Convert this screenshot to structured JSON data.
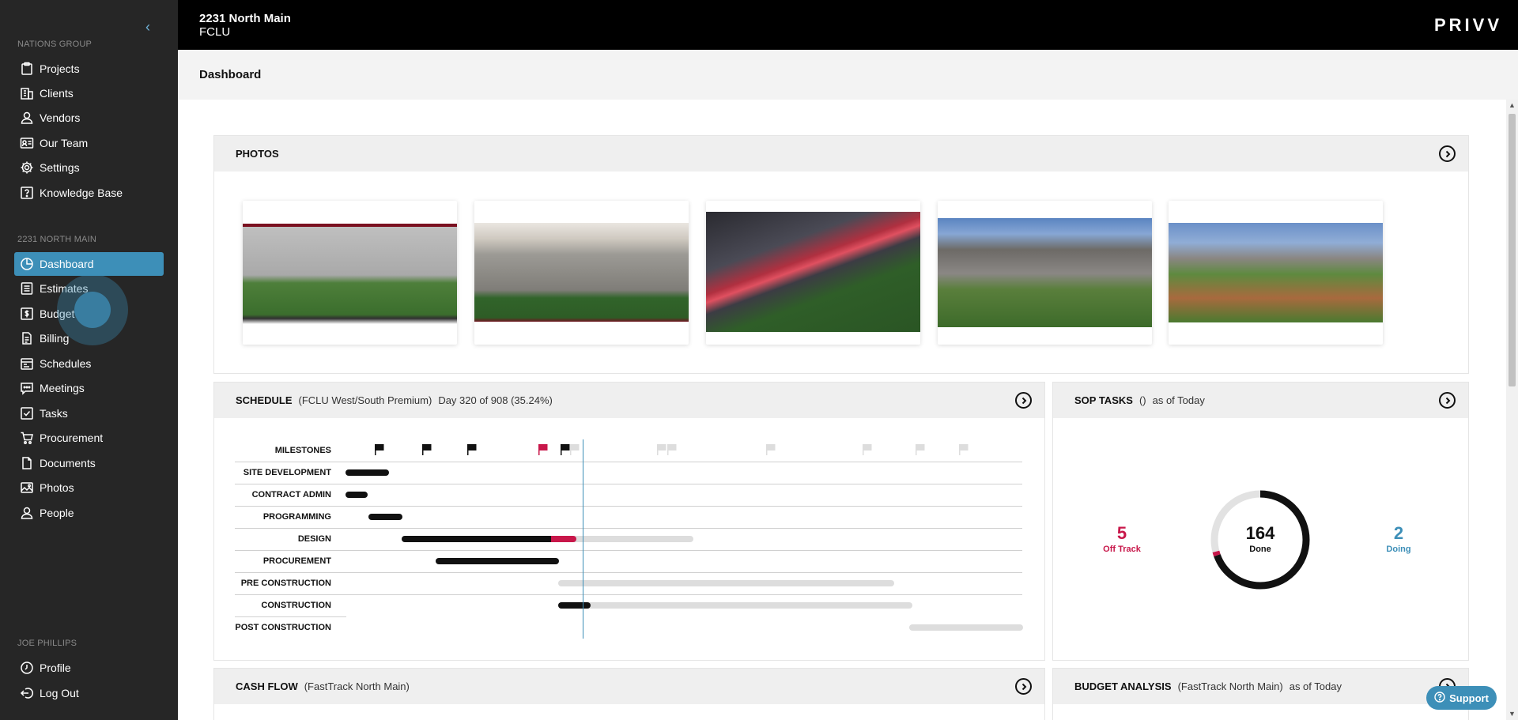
{
  "sidebar": {
    "group1_label": "NATIONS GROUP",
    "group1": [
      {
        "label": "Projects",
        "icon": "clipboard-icon"
      },
      {
        "label": "Clients",
        "icon": "building-icon"
      },
      {
        "label": "Vendors",
        "icon": "person-icon"
      },
      {
        "label": "Our Team",
        "icon": "id-card-icon"
      },
      {
        "label": "Settings",
        "icon": "gear-icon"
      },
      {
        "label": "Knowledge Base",
        "icon": "question-box-icon"
      }
    ],
    "group2_label": "2231 NORTH MAIN",
    "group2": [
      {
        "label": "Dashboard",
        "icon": "pie-icon",
        "active": true
      },
      {
        "label": "Estimates",
        "icon": "list-icon"
      },
      {
        "label": "Budget",
        "icon": "dollar-icon"
      },
      {
        "label": "Billing",
        "icon": "document-icon"
      },
      {
        "label": "Schedules",
        "icon": "calendar-icon"
      },
      {
        "label": "Meetings",
        "icon": "chat-icon"
      },
      {
        "label": "Tasks",
        "icon": "checkbox-icon"
      },
      {
        "label": "Procurement",
        "icon": "cart-icon"
      },
      {
        "label": "Documents",
        "icon": "file-icon"
      },
      {
        "label": "Photos",
        "icon": "image-icon"
      },
      {
        "label": "People",
        "icon": "person-icon"
      }
    ],
    "group3_label": "JOE PHILLIPS",
    "group3": [
      {
        "label": "Profile",
        "icon": "clock-icon"
      },
      {
        "label": "Log Out",
        "icon": "logout-icon"
      }
    ]
  },
  "topbar": {
    "project": "2231 North Main",
    "subproject": "FCLU",
    "brand": "PRIVV"
  },
  "page": {
    "title": "Dashboard"
  },
  "photos": {
    "title": "PHOTOS",
    "count": 5
  },
  "schedule": {
    "title": "SCHEDULE",
    "subtitle": "(FCLU West/South Premium)",
    "progress": "Day 320 of 908 (35.24%)",
    "rows": [
      "MILESTONES",
      "SITE DEVELOPMENT",
      "CONTRACT ADMIN",
      "PROGRAMMING",
      "DESIGN",
      "PROCUREMENT",
      "PRE CONSTRUCTION",
      "CONSTRUCTION",
      "POST CONSTRUCTION"
    ]
  },
  "sop": {
    "title": "SOP TASKS",
    "subtitle": "()",
    "asof": "as of Today",
    "off_track": "5",
    "off_track_label": "Off Track",
    "done": "164",
    "done_label": "Done",
    "doing": "2",
    "doing_label": "Doing"
  },
  "cashflow": {
    "title": "CASH FLOW",
    "subtitle": "(FastTrack North Main)"
  },
  "budget": {
    "title": "BUDGET ANALYSIS",
    "subtitle": "(FastTrack North Main)",
    "asof": "as of Today"
  },
  "support": {
    "label": "Support"
  },
  "colors": {
    "accent": "#3d8fb8",
    "red": "#c8174a",
    "dark": "#262626"
  }
}
